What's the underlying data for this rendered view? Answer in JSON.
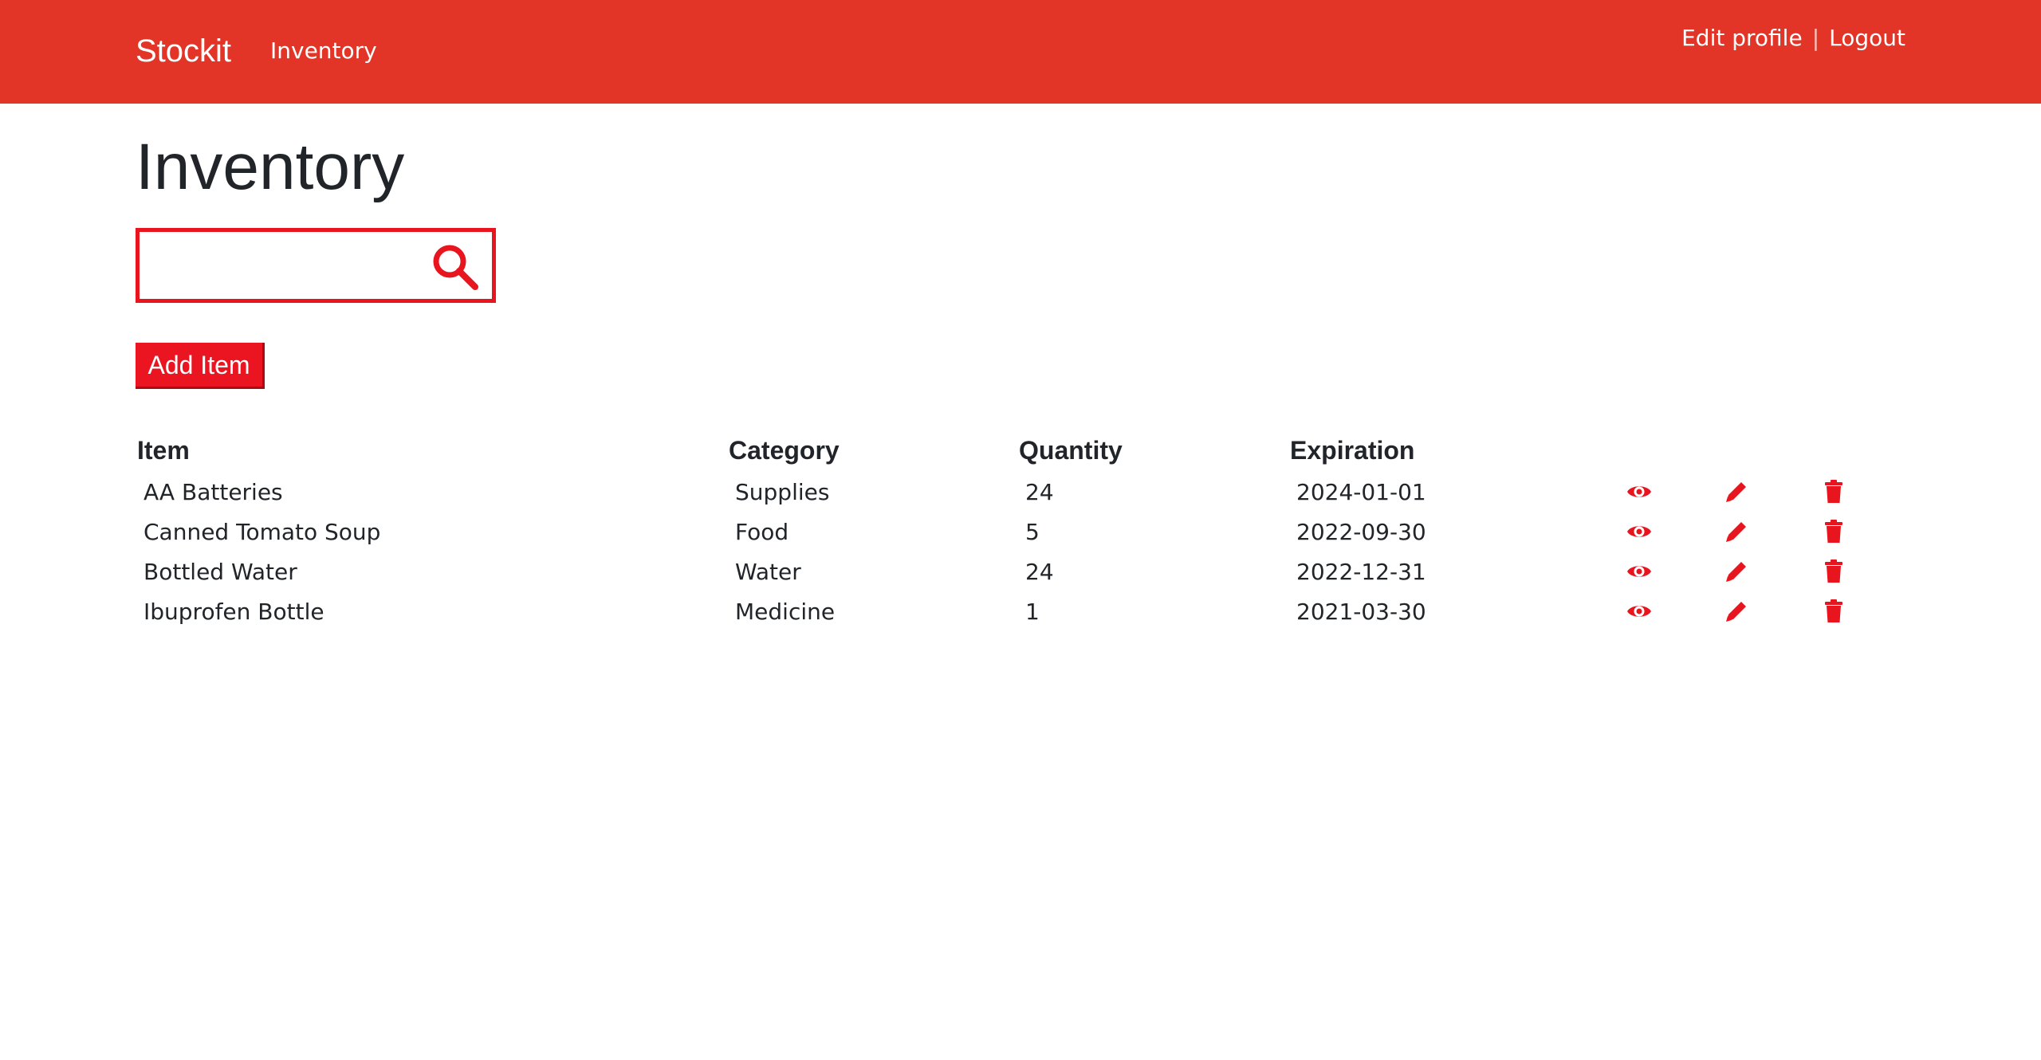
{
  "nav": {
    "brand": "Stockit",
    "inventory_link": "Inventory",
    "edit_profile": "Edit profile",
    "separator": "|",
    "logout": "Logout"
  },
  "page": {
    "title": "Inventory"
  },
  "search": {
    "value": "",
    "placeholder": "",
    "icon": "search-icon"
  },
  "actions": {
    "add_item": "Add Item"
  },
  "table": {
    "headers": [
      "Item",
      "Category",
      "Quantity",
      "Expiration"
    ],
    "rows": [
      {
        "item": "AA Batteries",
        "category": "Supplies",
        "quantity": "24",
        "expiration": "2024-01-01"
      },
      {
        "item": "Canned Tomato Soup",
        "category": "Food",
        "quantity": "5",
        "expiration": "2022-09-30"
      },
      {
        "item": "Bottled Water",
        "category": "Water",
        "quantity": "24",
        "expiration": "2022-12-31"
      },
      {
        "item": "Ibuprofen Bottle",
        "category": "Medicine",
        "quantity": "1",
        "expiration": "2021-03-30"
      }
    ],
    "row_icons": [
      "eye-icon",
      "pencil-icon",
      "trash-icon"
    ]
  },
  "colors": {
    "navbar": "#e33527",
    "accent": "#e8151f",
    "text": "#212529"
  }
}
